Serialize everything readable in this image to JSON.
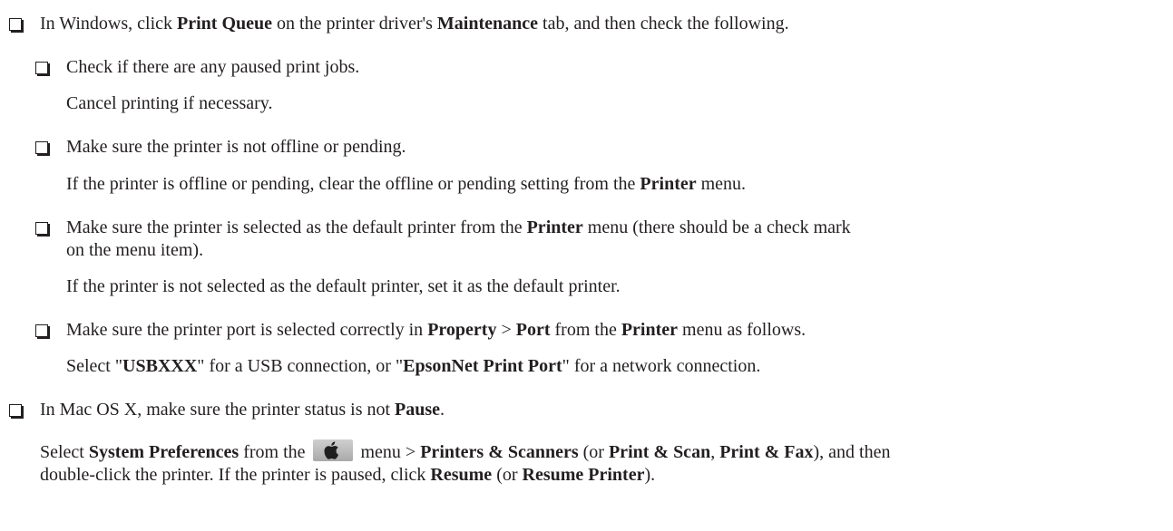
{
  "items": {
    "windows": {
      "pre": "In Windows, click ",
      "b1": "Print Queue",
      "mid": " on the printer driver's ",
      "b2": "Maintenance",
      "post": " tab, and then check the following."
    },
    "paused_jobs": {
      "text": "Check if there are any paused print jobs.",
      "note": "Cancel printing if necessary."
    },
    "offline": {
      "text": "Make sure the printer is not offline or pending.",
      "note_pre": "If the printer is offline or pending, clear the offline or pending setting from the ",
      "note_b": "Printer",
      "note_post": " menu."
    },
    "default_printer": {
      "pre": "Make sure the printer is selected as the default printer from the ",
      "b": "Printer",
      "post": " menu (there should be a check mark",
      "line2": "on the menu item).",
      "note": "If the printer is not selected as the default printer, set it as the default printer."
    },
    "port": {
      "pre": "Make sure the printer port is selected correctly in ",
      "b1": "Property",
      "sep": " > ",
      "b2": "Port",
      "mid": " from the ",
      "b3": "Printer",
      "post": " menu as follows.",
      "note_pre": "Select \"",
      "note_b1": "USBXXX",
      "note_mid": "\" for a USB connection, or \"",
      "note_b2": "EpsonNet Print Port",
      "note_post": "\" for a network connection."
    },
    "mac": {
      "pre": "In Mac OS X, make sure the printer status is not ",
      "b": "Pause",
      "post": ".",
      "p1_pre": "Select ",
      "p1_b1": "System Preferences",
      "p1_mid1": " from the ",
      "p1_mid2": " menu > ",
      "p1_b2": "Printers & Scanners",
      "p1_mid3": " (or ",
      "p1_b3": "Print & Scan",
      "p1_comma": ", ",
      "p1_b4": "Print & Fax",
      "p1_post": "), and then",
      "p2_pre": "double-click the printer. If the printer is paused, click ",
      "p2_b1": "Resume",
      "p2_mid": " (or ",
      "p2_b2": "Resume Printer",
      "p2_post": ")."
    }
  },
  "icons": {
    "menu_icon": "apple-logo-icon"
  }
}
